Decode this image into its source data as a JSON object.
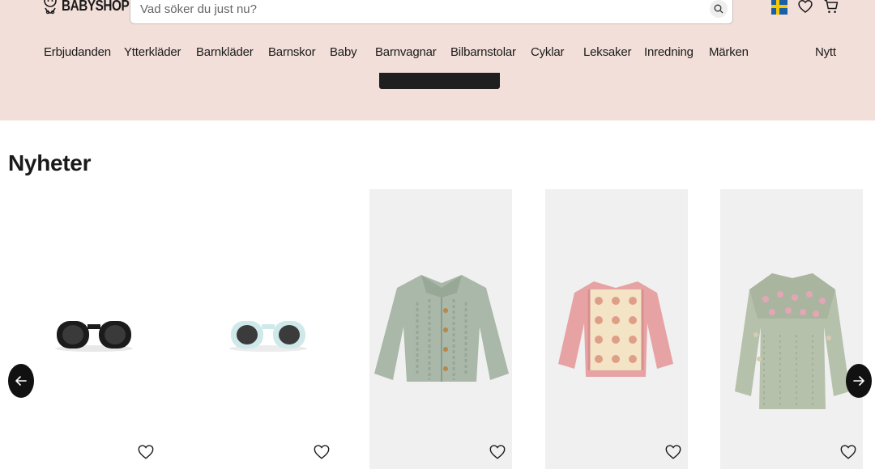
{
  "header": {
    "logo_text": "BABYSHOP",
    "search": {
      "placeholder": "Vad söker du just nu?"
    },
    "icons": [
      "sweden-flag-icon",
      "heart-icon",
      "cart-icon"
    ]
  },
  "nav": {
    "items": [
      "Erbjudanden",
      "Ytterkläder",
      "Barnkläder",
      "Barnskor",
      "Baby",
      "Barnvagnar",
      "Bilbarnstolar",
      "Cyklar",
      "Leksaker",
      "Inredning",
      "Märken"
    ],
    "right_item": "Nytt"
  },
  "section": {
    "title": "Nyheter"
  },
  "products": [
    {
      "image": "black-sunglasses",
      "background": "#ffffff"
    },
    {
      "image": "light-blue-sunglasses",
      "background": "#ffffff"
    },
    {
      "image": "sage-cable-knit-cardigan",
      "background": "#f0f0f0"
    },
    {
      "image": "pink-granny-square-cardigan",
      "background": "#f0f0f0"
    },
    {
      "image": "sage-embroidered-sweater",
      "background": "#f0f0f0"
    }
  ],
  "colors": {
    "header_bg": "#f3dfd9",
    "text": "#1a1a1a",
    "arrow_bg": "#111111",
    "card_bg": "#f0f0f0"
  }
}
